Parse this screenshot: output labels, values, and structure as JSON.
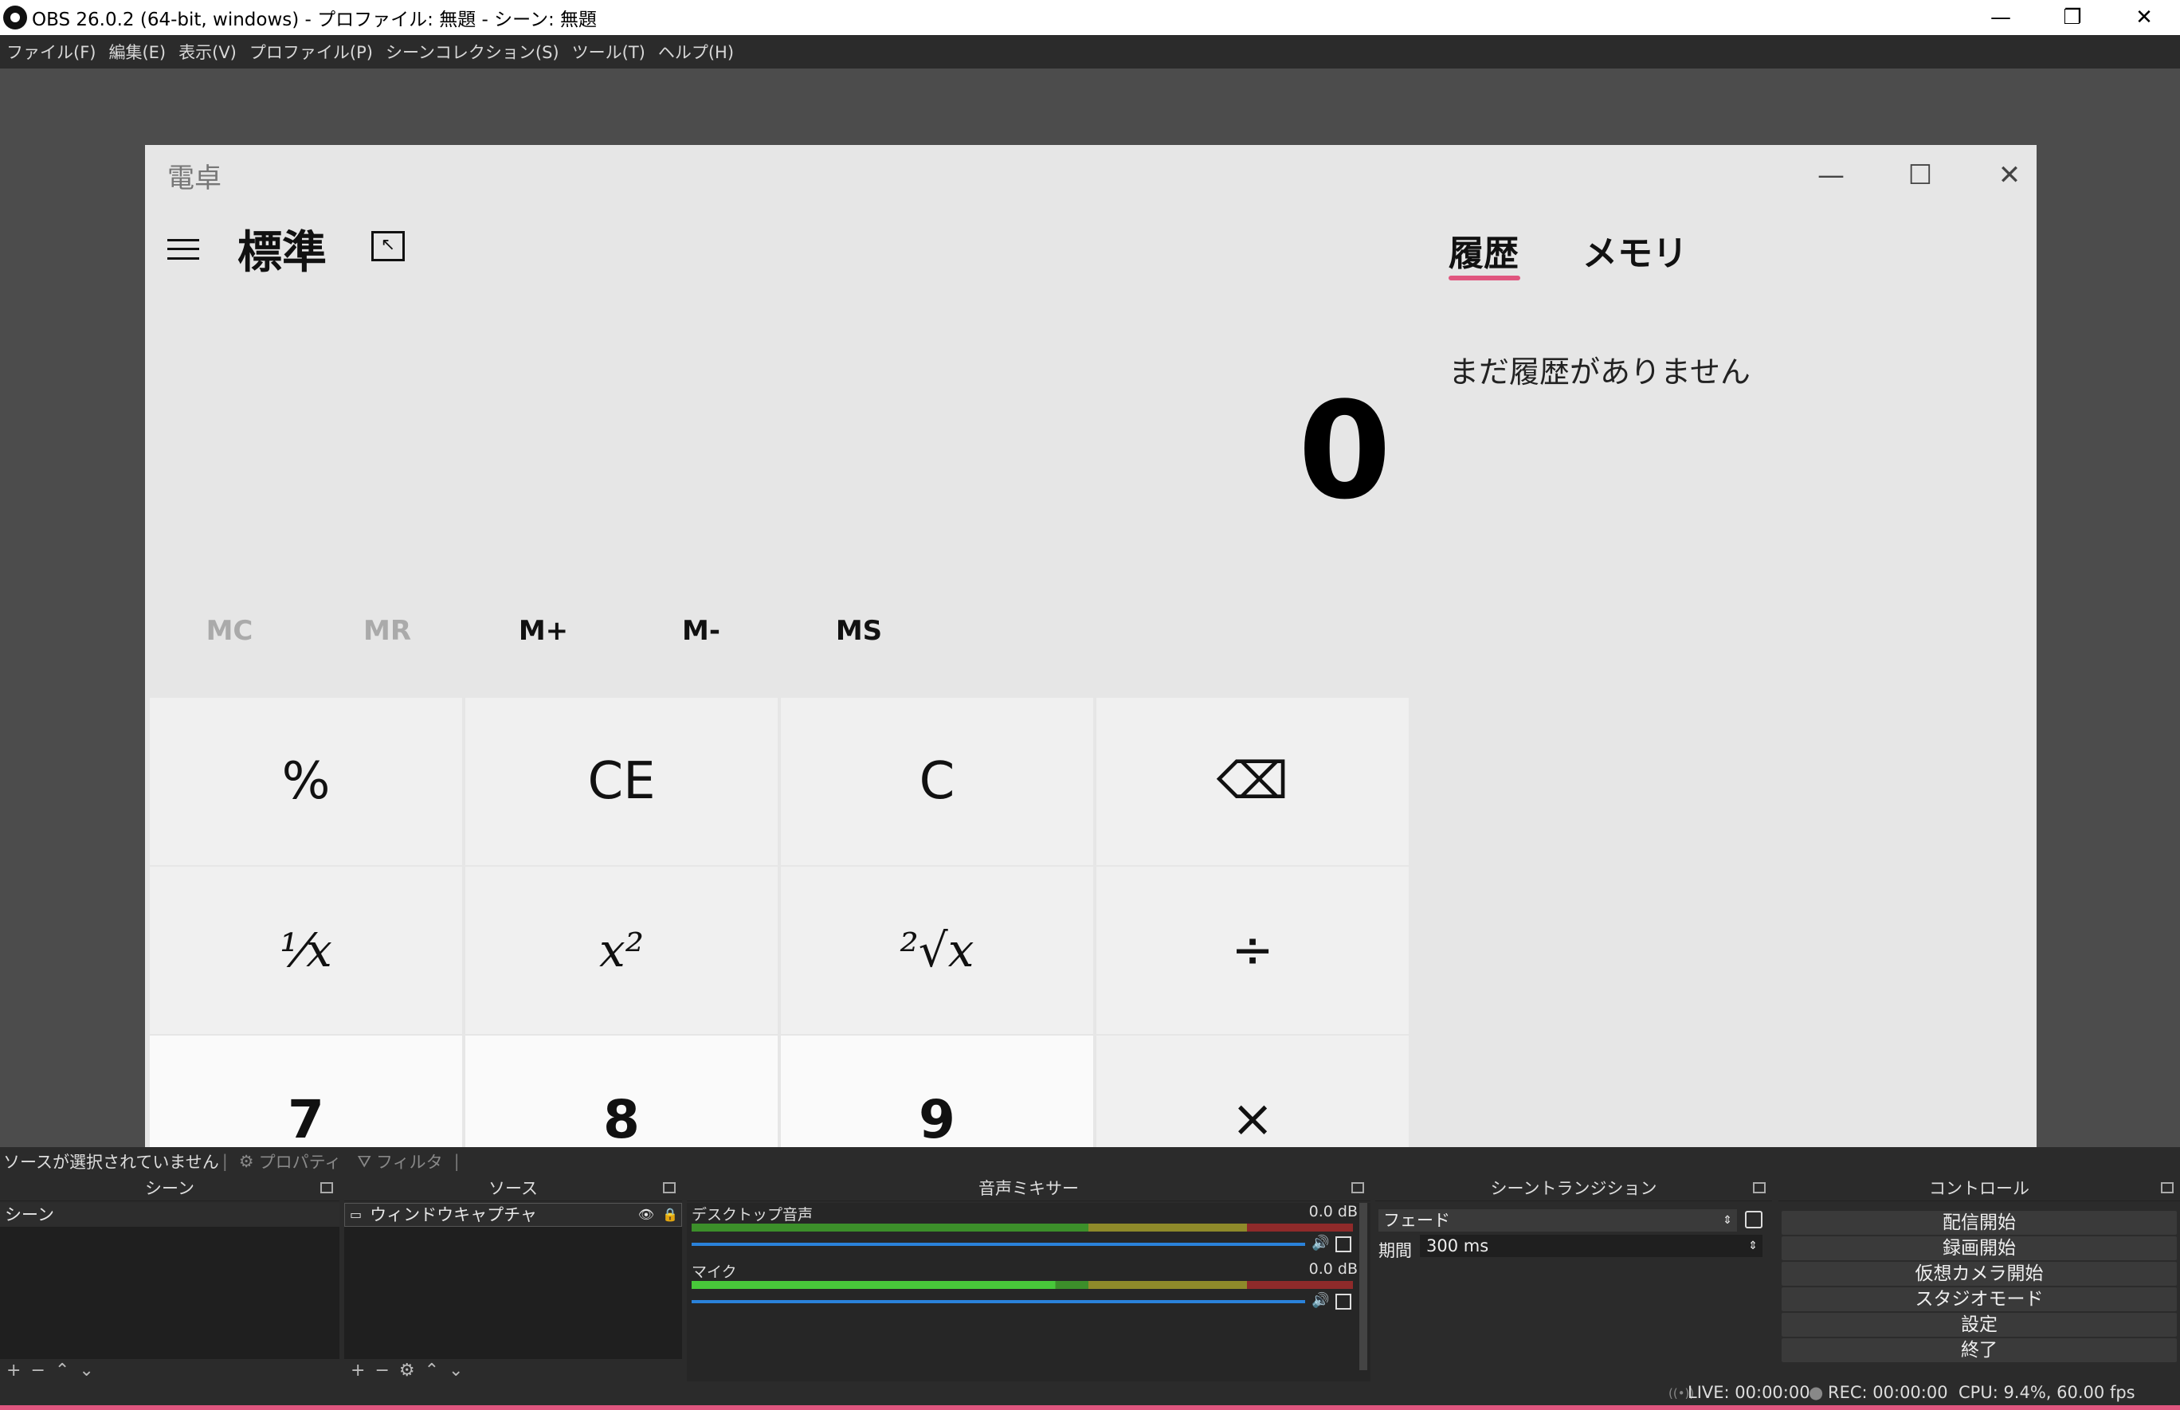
{
  "window": {
    "title": "OBS 26.0.2 (64-bit, windows) - プロファイル: 無題 - シーン: 無題"
  },
  "menu": [
    "ファイル(F)",
    "編集(E)",
    "表示(V)",
    "プロファイル(P)",
    "シーンコレクション(S)",
    "ツール(T)",
    "ヘルプ(H)"
  ],
  "calculator": {
    "app_title": "電卓",
    "mode": "標準",
    "display": "0",
    "memory_buttons": [
      {
        "label": "MC",
        "enabled": false
      },
      {
        "label": "MR",
        "enabled": false
      },
      {
        "label": "M+",
        "enabled": true
      },
      {
        "label": "M-",
        "enabled": true
      },
      {
        "label": "MS",
        "enabled": true
      }
    ],
    "keys": [
      "%",
      "CE",
      "C",
      "⌫",
      "¹⁄x",
      "x²",
      "²√x",
      "÷",
      "7",
      "8",
      "9",
      "×"
    ],
    "tabs": [
      "履歴",
      "メモリ"
    ],
    "history_empty": "まだ履歴がありません"
  },
  "source_toolbar": {
    "no_source": "ソースが選択されていません",
    "properties": "プロパティ",
    "filters": "フィルタ"
  },
  "docks": {
    "scenes": {
      "title": "シーン",
      "items": [
        "シーン"
      ]
    },
    "sources": {
      "title": "ソース",
      "items": [
        "ウィンドウキャプチャ"
      ]
    },
    "mixer": {
      "title": "音声ミキサー",
      "channels": [
        {
          "name": "デスクトップ音声",
          "db": "0.0 dB"
        },
        {
          "name": "マイク",
          "db": "0.0 dB"
        }
      ]
    },
    "transitions": {
      "title": "シーントランジション",
      "type": "フェード",
      "duration_label": "期間",
      "duration": "300 ms"
    },
    "controls": {
      "title": "コントロール",
      "buttons": [
        "配信開始",
        "録画開始",
        "仮想カメラ開始",
        "スタジオモード",
        "設定",
        "終了"
      ]
    }
  },
  "status": {
    "live": "LIVE: 00:00:00",
    "rec": "REC: 00:00:00",
    "cpu": "CPU: 9.4%, 60.00 fps"
  }
}
